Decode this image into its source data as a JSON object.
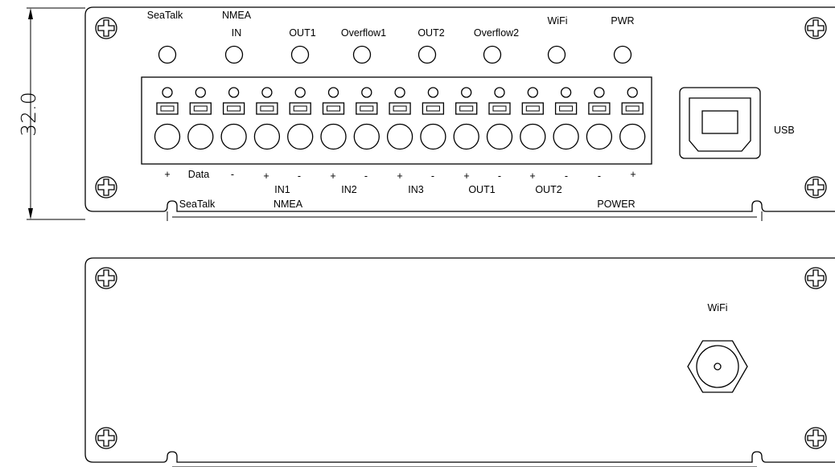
{
  "dimension": {
    "value": "32.0"
  },
  "front_panel": {
    "led_labels": {
      "seatalk": "SeaTalk",
      "nmea": "NMEA",
      "in": "IN",
      "out1": "OUT1",
      "overflow1": "Overflow1",
      "out2": "OUT2",
      "overflow2": "Overflow2",
      "wifi": "WiFi",
      "pwr": "PWR"
    },
    "led_count": 8,
    "terminal_count": 15,
    "usb_label": "USB",
    "pin_labels": [
      "+",
      "Data",
      "-",
      "+",
      "-",
      "+",
      "-",
      "+",
      "-",
      "+",
      "-",
      "+",
      "-",
      "-",
      "+"
    ],
    "group_labels": {
      "in1": "IN1",
      "in2": "IN2",
      "in3": "IN3",
      "out1": "OUT1",
      "out2": "OUT2",
      "seatalk": "SeaTalk",
      "nmea": "NMEA",
      "power": "POWER"
    }
  },
  "back_panel": {
    "antenna_label": "WiFi"
  }
}
